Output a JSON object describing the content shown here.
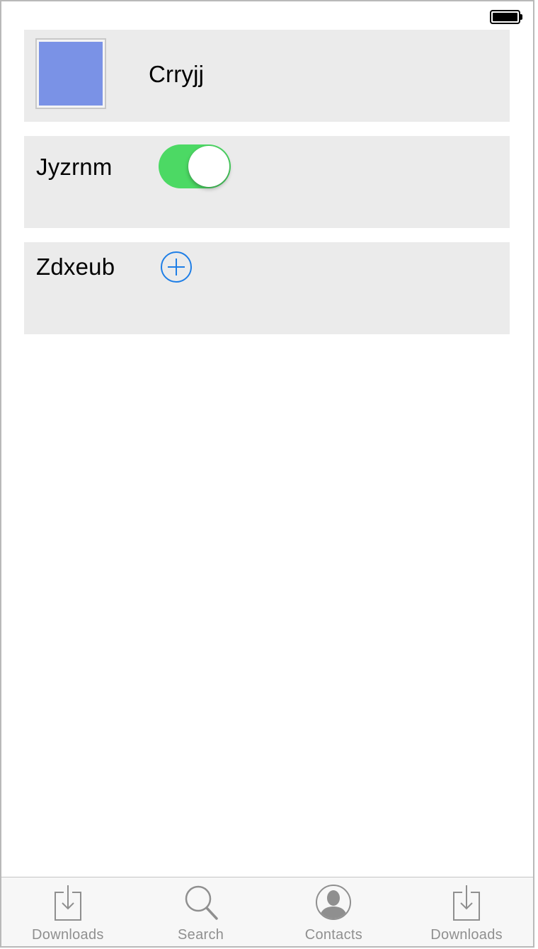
{
  "colors": {
    "thumbnail": "#7a92e6",
    "toggle_on": "#4cd964",
    "add_icon": "#1e7ee6",
    "tab_inactive": "#8f8f8f",
    "cell_background": "#ebebeb"
  },
  "list": {
    "items": [
      {
        "title": "Crryjj",
        "accessory": "thumbnail"
      },
      {
        "title": "Jyzrnm",
        "accessory": "toggle",
        "toggle_on": true
      },
      {
        "title": "Zdxeub",
        "accessory": "add-icon"
      }
    ]
  },
  "tab_bar": {
    "tabs": [
      {
        "label": "Downloads",
        "icon": "download-icon"
      },
      {
        "label": "Search",
        "icon": "search-icon"
      },
      {
        "label": "Contacts",
        "icon": "contacts-icon"
      },
      {
        "label": "Downloads",
        "icon": "download-icon"
      }
    ]
  }
}
